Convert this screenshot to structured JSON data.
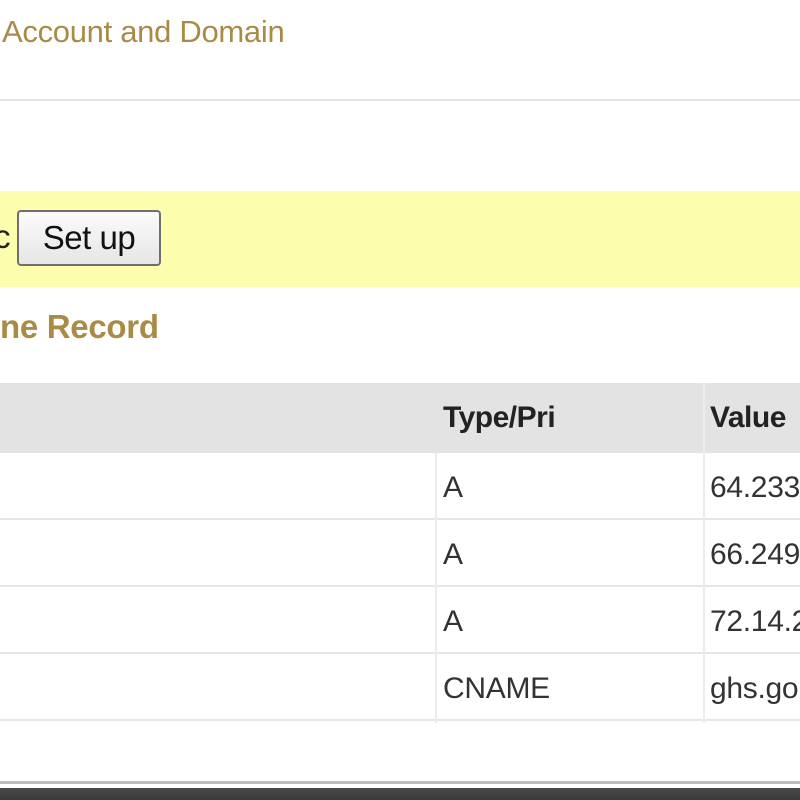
{
  "header": {
    "title": "Account and Domain"
  },
  "notice": {
    "prefix_text": "c",
    "setup_button_label": "Set up"
  },
  "section": {
    "title": "ne Record"
  },
  "table": {
    "columns": {
      "name": "",
      "type": "Type/Pri",
      "value": "Value"
    },
    "rows": [
      {
        "name": "",
        "type": "A",
        "value": "64.233"
      },
      {
        "name": "",
        "type": "A",
        "value": "66.249"
      },
      {
        "name": "",
        "type": "A",
        "value": "72.14.2"
      },
      {
        "name": "",
        "type": "CNAME",
        "value": "ghs.go"
      }
    ]
  },
  "colors": {
    "accent_brown": "#a98b47",
    "notice_yellow": "#fdfdae",
    "header_gray": "#e3e3e3"
  }
}
